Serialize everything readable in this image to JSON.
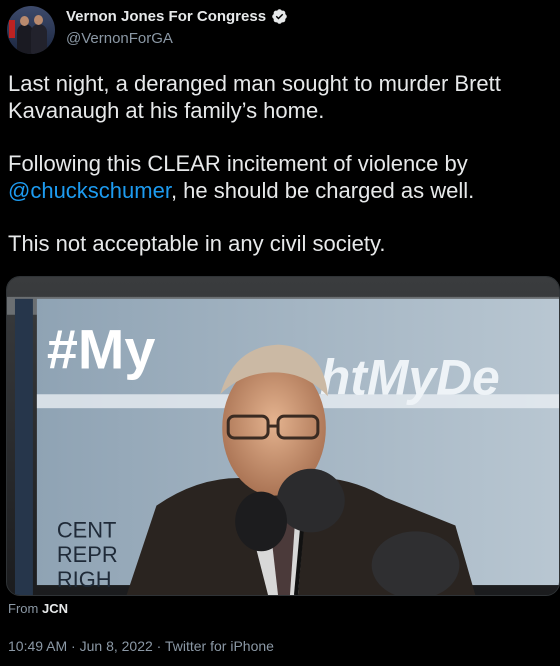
{
  "account": {
    "display_name": "Vernon Jones For Congress",
    "handle": "@VernonForGA",
    "verified": true
  },
  "tweet": {
    "line1": "Last night,  a deranged man sought to murder Brett Kavanaugh at his family’s home.",
    "line2_pre": "Following this CLEAR incitement of violence by ",
    "line2_mention": "@chuckschumer",
    "line2_post": ", he should be charged as well.",
    "line3": "This not acceptable in any civil society."
  },
  "media": {
    "banner_text": "#My",
    "banner_text_right": "htMyDe",
    "sign_lines": [
      "CENT",
      "REPR",
      "RIGH"
    ]
  },
  "source": {
    "prefix": "From",
    "name": "JCN"
  },
  "meta": {
    "time": "10:49 AM",
    "date": "Jun 8, 2022",
    "client": "Twitter for iPhone",
    "separator": " · "
  },
  "colors": {
    "background": "#000000",
    "text": "#e7e9ea",
    "secondary": "#8b98a5",
    "link": "#1d9bf0"
  }
}
